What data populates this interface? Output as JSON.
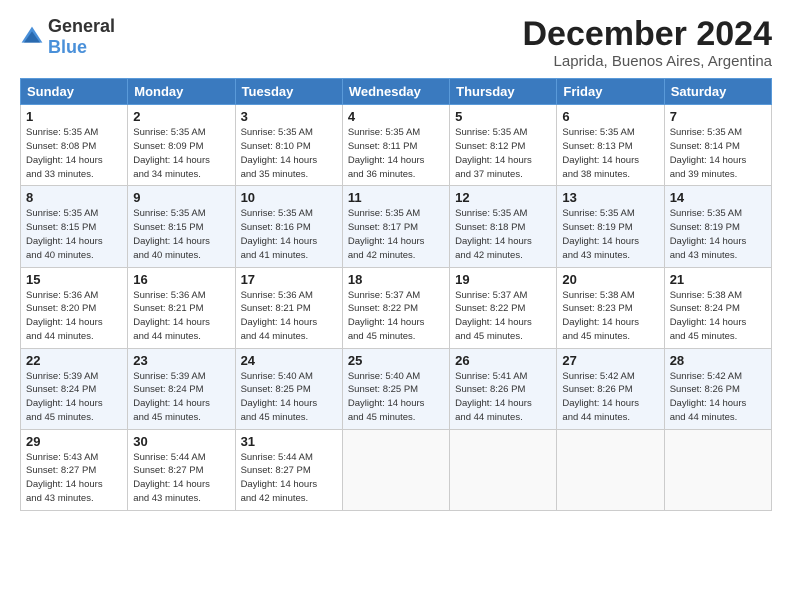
{
  "header": {
    "logo_general": "General",
    "logo_blue": "Blue",
    "title": "December 2024",
    "subtitle": "Laprida, Buenos Aires, Argentina"
  },
  "weekdays": [
    "Sunday",
    "Monday",
    "Tuesday",
    "Wednesday",
    "Thursday",
    "Friday",
    "Saturday"
  ],
  "weeks": [
    [
      {
        "day": "1",
        "info": "Sunrise: 5:35 AM\nSunset: 8:08 PM\nDaylight: 14 hours\nand 33 minutes."
      },
      {
        "day": "2",
        "info": "Sunrise: 5:35 AM\nSunset: 8:09 PM\nDaylight: 14 hours\nand 34 minutes."
      },
      {
        "day": "3",
        "info": "Sunrise: 5:35 AM\nSunset: 8:10 PM\nDaylight: 14 hours\nand 35 minutes."
      },
      {
        "day": "4",
        "info": "Sunrise: 5:35 AM\nSunset: 8:11 PM\nDaylight: 14 hours\nand 36 minutes."
      },
      {
        "day": "5",
        "info": "Sunrise: 5:35 AM\nSunset: 8:12 PM\nDaylight: 14 hours\nand 37 minutes."
      },
      {
        "day": "6",
        "info": "Sunrise: 5:35 AM\nSunset: 8:13 PM\nDaylight: 14 hours\nand 38 minutes."
      },
      {
        "day": "7",
        "info": "Sunrise: 5:35 AM\nSunset: 8:14 PM\nDaylight: 14 hours\nand 39 minutes."
      }
    ],
    [
      {
        "day": "8",
        "info": "Sunrise: 5:35 AM\nSunset: 8:15 PM\nDaylight: 14 hours\nand 40 minutes."
      },
      {
        "day": "9",
        "info": "Sunrise: 5:35 AM\nSunset: 8:15 PM\nDaylight: 14 hours\nand 40 minutes."
      },
      {
        "day": "10",
        "info": "Sunrise: 5:35 AM\nSunset: 8:16 PM\nDaylight: 14 hours\nand 41 minutes."
      },
      {
        "day": "11",
        "info": "Sunrise: 5:35 AM\nSunset: 8:17 PM\nDaylight: 14 hours\nand 42 minutes."
      },
      {
        "day": "12",
        "info": "Sunrise: 5:35 AM\nSunset: 8:18 PM\nDaylight: 14 hours\nand 42 minutes."
      },
      {
        "day": "13",
        "info": "Sunrise: 5:35 AM\nSunset: 8:19 PM\nDaylight: 14 hours\nand 43 minutes."
      },
      {
        "day": "14",
        "info": "Sunrise: 5:35 AM\nSunset: 8:19 PM\nDaylight: 14 hours\nand 43 minutes."
      }
    ],
    [
      {
        "day": "15",
        "info": "Sunrise: 5:36 AM\nSunset: 8:20 PM\nDaylight: 14 hours\nand 44 minutes."
      },
      {
        "day": "16",
        "info": "Sunrise: 5:36 AM\nSunset: 8:21 PM\nDaylight: 14 hours\nand 44 minutes."
      },
      {
        "day": "17",
        "info": "Sunrise: 5:36 AM\nSunset: 8:21 PM\nDaylight: 14 hours\nand 44 minutes."
      },
      {
        "day": "18",
        "info": "Sunrise: 5:37 AM\nSunset: 8:22 PM\nDaylight: 14 hours\nand 45 minutes."
      },
      {
        "day": "19",
        "info": "Sunrise: 5:37 AM\nSunset: 8:22 PM\nDaylight: 14 hours\nand 45 minutes."
      },
      {
        "day": "20",
        "info": "Sunrise: 5:38 AM\nSunset: 8:23 PM\nDaylight: 14 hours\nand 45 minutes."
      },
      {
        "day": "21",
        "info": "Sunrise: 5:38 AM\nSunset: 8:24 PM\nDaylight: 14 hours\nand 45 minutes."
      }
    ],
    [
      {
        "day": "22",
        "info": "Sunrise: 5:39 AM\nSunset: 8:24 PM\nDaylight: 14 hours\nand 45 minutes."
      },
      {
        "day": "23",
        "info": "Sunrise: 5:39 AM\nSunset: 8:24 PM\nDaylight: 14 hours\nand 45 minutes."
      },
      {
        "day": "24",
        "info": "Sunrise: 5:40 AM\nSunset: 8:25 PM\nDaylight: 14 hours\nand 45 minutes."
      },
      {
        "day": "25",
        "info": "Sunrise: 5:40 AM\nSunset: 8:25 PM\nDaylight: 14 hours\nand 45 minutes."
      },
      {
        "day": "26",
        "info": "Sunrise: 5:41 AM\nSunset: 8:26 PM\nDaylight: 14 hours\nand 44 minutes."
      },
      {
        "day": "27",
        "info": "Sunrise: 5:42 AM\nSunset: 8:26 PM\nDaylight: 14 hours\nand 44 minutes."
      },
      {
        "day": "28",
        "info": "Sunrise: 5:42 AM\nSunset: 8:26 PM\nDaylight: 14 hours\nand 44 minutes."
      }
    ],
    [
      {
        "day": "29",
        "info": "Sunrise: 5:43 AM\nSunset: 8:27 PM\nDaylight: 14 hours\nand 43 minutes."
      },
      {
        "day": "30",
        "info": "Sunrise: 5:44 AM\nSunset: 8:27 PM\nDaylight: 14 hours\nand 43 minutes."
      },
      {
        "day": "31",
        "info": "Sunrise: 5:44 AM\nSunset: 8:27 PM\nDaylight: 14 hours\nand 42 minutes."
      },
      {
        "day": "",
        "info": ""
      },
      {
        "day": "",
        "info": ""
      },
      {
        "day": "",
        "info": ""
      },
      {
        "day": "",
        "info": ""
      }
    ]
  ]
}
